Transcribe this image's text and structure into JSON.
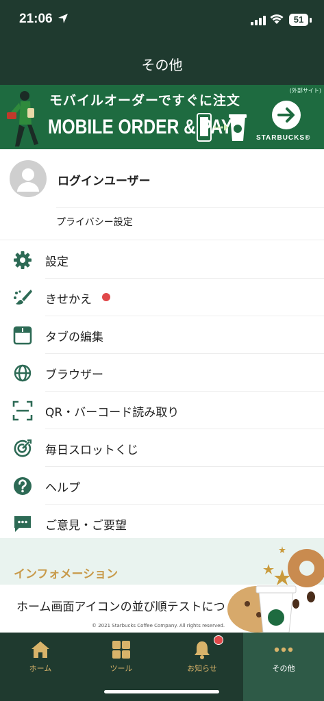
{
  "status_bar": {
    "time": "21:06",
    "battery": "51"
  },
  "nav": {
    "title": "その他"
  },
  "banner": {
    "external_note": "(外部サイト)",
    "headline_jp": "モバイルオーダーですぐに注文",
    "headline_en": "MOBILE ORDER & PAY",
    "brand": "STARBUCKS®",
    "brand_color": "#1e6b40"
  },
  "user": {
    "name": "ログインユーザー",
    "privacy_label": "プライバシー設定"
  },
  "menu": {
    "items": [
      {
        "label": "設定",
        "icon": "gear-icon"
      },
      {
        "label": "きせかえ",
        "icon": "brush-icon",
        "badge": true
      },
      {
        "label": "タブの編集",
        "icon": "tab-window-icon"
      },
      {
        "label": "ブラウザー",
        "icon": "globe-icon"
      },
      {
        "label": "QR・バーコード読み取り",
        "icon": "scan-icon"
      },
      {
        "label": "毎日スロットくじ",
        "icon": "target-icon"
      },
      {
        "label": "ヘルプ",
        "icon": "help-icon"
      },
      {
        "label": "ご意見・ご要望",
        "icon": "chat-icon"
      }
    ]
  },
  "info": {
    "heading": "インフォメーション",
    "news": "ホーム画面アイコンの並び順テストにつ",
    "copyright": "© 2021 Starbucks Coffee Company. All rights reserved."
  },
  "tabs": [
    {
      "label": "ホーム",
      "icon": "home-icon"
    },
    {
      "label": "ツール",
      "icon": "tools-grid-icon"
    },
    {
      "label": "お知らせ",
      "icon": "bell-icon",
      "badge": true
    },
    {
      "label": "その他",
      "icon": "more-dots-icon",
      "active": true
    }
  ],
  "colors": {
    "dark_green": "#1f3a2f",
    "icon_green": "#2d6a55",
    "gold": "#d8b36a",
    "badge_red": "#e0484a"
  }
}
